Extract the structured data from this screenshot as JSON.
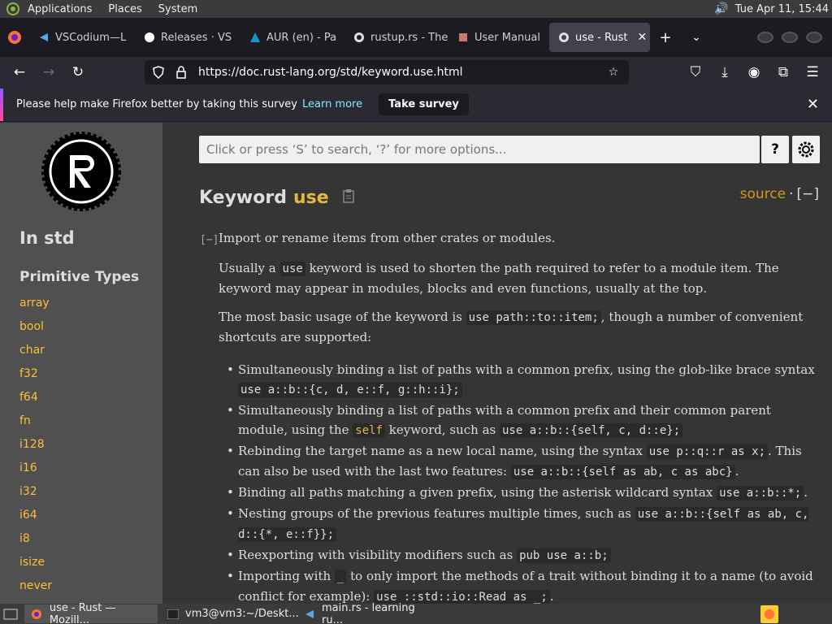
{
  "system_panel": {
    "menus": [
      "Applications",
      "Places",
      "System"
    ],
    "clock": "Tue Apr 11, 15:44"
  },
  "browser": {
    "tabs": [
      {
        "label": "VSCodium—L",
        "icon": "vscodium-icon"
      },
      {
        "label": "Releases · VS",
        "icon": "github-icon"
      },
      {
        "label": "AUR (en) - Pa",
        "icon": "arch-icon"
      },
      {
        "label": "rustup.rs - The",
        "icon": "rust-icon"
      },
      {
        "label": "User Manual",
        "icon": "manual-icon"
      },
      {
        "label": "use - Rust",
        "icon": "rust-icon",
        "active": true
      }
    ],
    "url": "https://doc.rust-lang.org/std/keyword.use.html"
  },
  "notification": {
    "message": "Please help make Firefox better by taking this survey",
    "link": "Learn more",
    "button": "Take survey"
  },
  "sidebar": {
    "crate_title": "In std",
    "section": "Primitive Types",
    "items": [
      "array",
      "bool",
      "char",
      "f32",
      "f64",
      "fn",
      "i128",
      "i16",
      "i32",
      "i64",
      "i8",
      "isize",
      "never"
    ]
  },
  "doc": {
    "search_placeholder": "Click or press ‘S’ to search, ‘?’ for more options...",
    "help_label": "?",
    "heading_prefix": "Keyword",
    "heading_keyword": "use",
    "source_label": "source",
    "source_sep": "·",
    "collapse_label": "[−]",
    "collapse_small": "[−]",
    "summary": "Import or rename items from other crates or modules.",
    "para1_a": "Usually a",
    "para1_code": "use",
    "para1_b": "keyword is used to shorten the path required to refer to a module item. The keyword may appear in modules, blocks and even functions, usually at the top.",
    "para2_a": "The most basic usage of the keyword is",
    "para2_code": "use path::to::item;",
    "para2_b": ", though a number of convenient shortcuts are supported:",
    "b1_text": "Simultaneously binding a list of paths with a common prefix, using the glob-like brace syntax",
    "b1_code": "use a::b::{c, d, e::f, g::h::i};",
    "b2_a": "Simultaneously binding a list of paths with a common prefix and their common parent module, using the",
    "b2_kw": "self",
    "b2_b": "keyword, such as",
    "b2_code": "use a::b::{self, c, d::e};",
    "b3_a": "Rebinding the target name as a new local name, using the syntax",
    "b3_code1": "use p::q::r as x;",
    "b3_b": ". This can also be used with the last two features:",
    "b3_code2": "use a::b::{self as ab, c as abc}",
    "b3_c": ".",
    "b4_a": "Binding all paths matching a given prefix, using the asterisk wildcard syntax",
    "b4_code": "use a::b::*;",
    "b4_b": ".",
    "b5_a": "Nesting groups of the previous features multiple times, such as",
    "b5_code": "use a::b::{self as ab, c, d::{*, e::f}};",
    "b6_a": "Reexporting with visibility modifiers such as",
    "b6_code": "pub use a::b;",
    "b7_a": "Importing with",
    "b7_code1": "_",
    "b7_b": "to only import the methods of a trait without binding it to a name (to avoid conflict for example):",
    "b7_code2": "use ::std::io::Read as _;",
    "b7_c": "."
  },
  "taskbar": {
    "tasks": [
      {
        "label": "use - Rust — Mozill...",
        "icon": "firefox-icon",
        "active": true
      },
      {
        "label": "vm3@vm3:~/Deskt...",
        "icon": "terminal-icon"
      },
      {
        "label": "main.rs - learning ru...",
        "icon": "vscodium-icon"
      }
    ]
  },
  "colors": {
    "keyword": "#e5b73f",
    "sidebar_link": "#fdbf35",
    "source_link": "#d2991d",
    "page_bg": "#353535",
    "sidebar_bg": "#505050"
  }
}
